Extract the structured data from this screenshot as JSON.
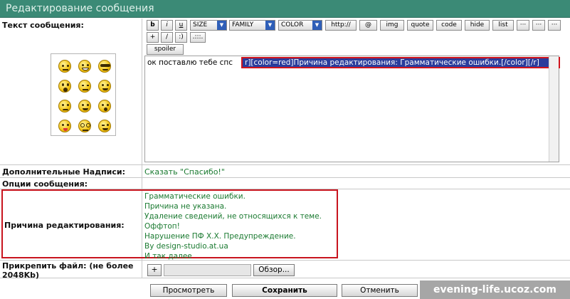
{
  "window": {
    "title": "Редактирование сообщения"
  },
  "labels": {
    "message_text": "Текст сообщения:",
    "extra_captions": "Дополнительные Надписи:",
    "message_options": "Опции сообщения:",
    "edit_reason": "Причина редактирования:",
    "attach_file": "Прикрепить файл: (не более 2048Kb)"
  },
  "toolbar": {
    "b": "b",
    "i": "i",
    "u": "u",
    "size": "SIZE",
    "family": "FAMILY",
    "color": "COLOR",
    "http": "http://",
    "at": "@",
    "img": "img",
    "quote": "quote",
    "code": "code",
    "hide": "hide",
    "list": "list",
    "more1": "···",
    "more2": "···",
    "more3": "···",
    "plus": "+",
    "slash": "/",
    "smiley": ":)",
    "dots": ".:::.",
    "spoiler": "spoiler"
  },
  "editor": {
    "text_plain": "ок поставлю тебе спс",
    "text_selected": "r][color=red]Причина редактирования: Грамматические ошибки.[/color][/r]"
  },
  "extra_captions_value": "Сказать \"Спасибо!\"",
  "reasons": [
    "Грамматические ошибки.",
    "Причина не указана.",
    "Удаление сведений, не относящихся к теме.",
    "Оффтоп!",
    "Нарушение ПФ Х.Х. Предупреждение.",
    "By design-studio.at.ua",
    "И так далее"
  ],
  "file": {
    "add": "+",
    "browse": "Обзор..."
  },
  "buttons": {
    "preview": "Просмотреть",
    "save": "Сохранить",
    "cancel": "Отменить"
  },
  "watermark": "evening-life.ucoz.com",
  "colors": {
    "title_bar": "#3b8a76",
    "selection": "#2a3c9c",
    "highlight_border": "#c8141e",
    "green_text": "#1a7a30"
  }
}
